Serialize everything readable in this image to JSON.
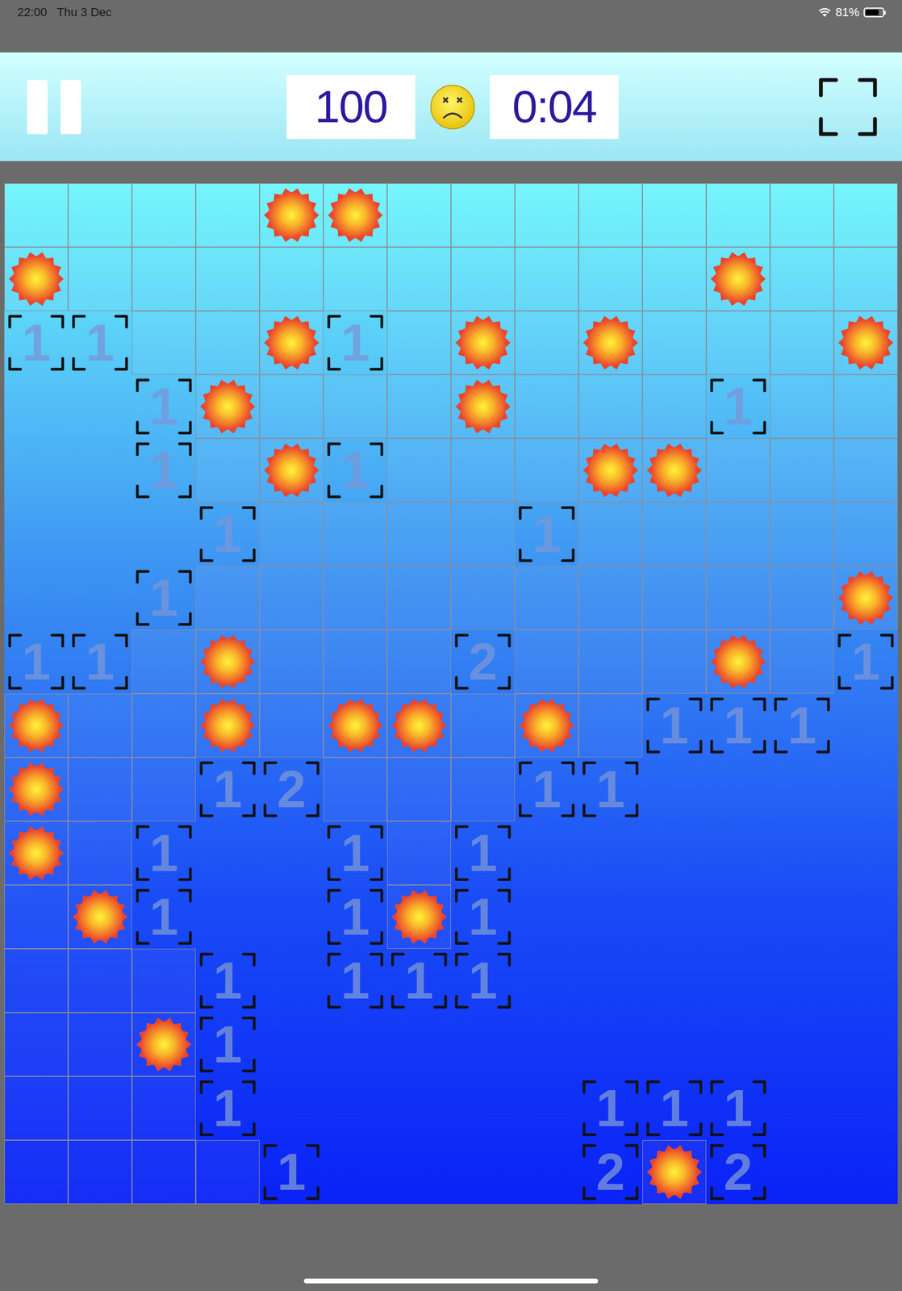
{
  "status_bar": {
    "time": "22:00",
    "date": "Thu 3 Dec",
    "battery": "81%",
    "battery_level": 0.81
  },
  "header": {
    "mines_left": "100",
    "lost": true,
    "timer": "0:04"
  },
  "board": {
    "rows": [
      "HHHHMMHHHHHHHH",
      "MHHHHHHHHHHMHH",
      "11HHM1HMHMHHHM",
      "..1MHHHMHHH1HH",
      "..1HM1HHHMMHHH",
      "...1HHHH1HHHHH",
      "..1HHHHHHHHHHM",
      "11HMHHH2HHHMH1",
      "MHHMHMMHMH111.",
      "MHH12HHH11....",
      "MH1..1H1......",
      "HM1..1M1......",
      "HHH1.111......",
      "HHM1..........",
      "HHH1.....111..",
      "HHHH1....2M2.."
    ]
  }
}
